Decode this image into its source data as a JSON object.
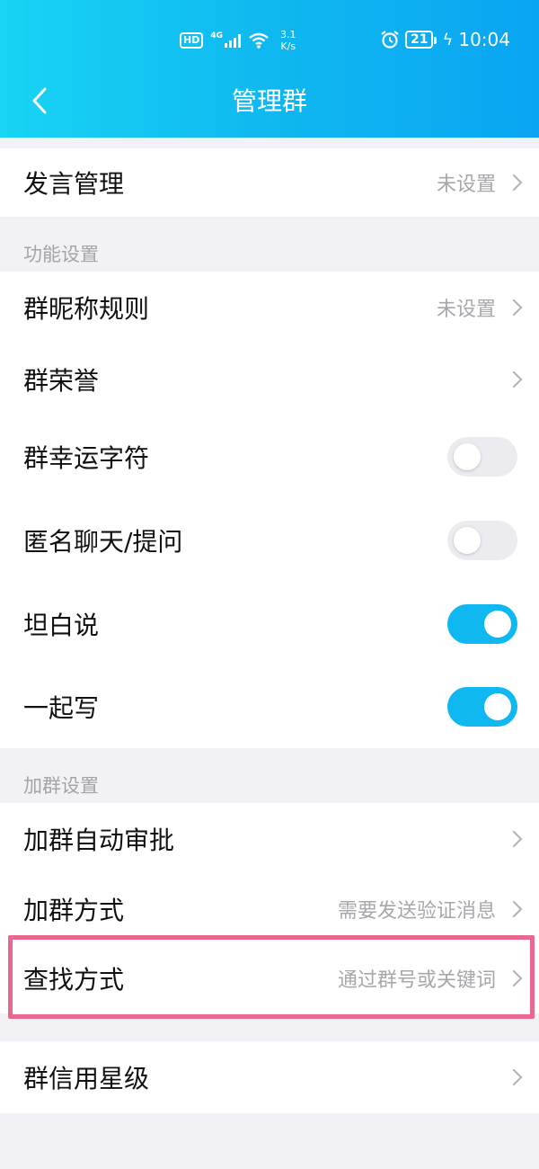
{
  "status_bar": {
    "hd": "HD",
    "network": "4G",
    "speed_value": "3.1",
    "speed_unit": "K/s",
    "battery": "21",
    "time": "10:04"
  },
  "header": {
    "title": "管理群"
  },
  "rows": {
    "speech_mgmt": {
      "label": "发言管理",
      "value": "未设置"
    },
    "nickname_rule": {
      "label": "群昵称规则",
      "value": "未设置"
    },
    "honor": {
      "label": "群荣誉"
    },
    "lucky_char": {
      "label": "群幸运字符",
      "toggle": false
    },
    "anonymous": {
      "label": "匿名聊天/提问",
      "toggle": false
    },
    "confession": {
      "label": "坦白说",
      "toggle": true
    },
    "write_together": {
      "label": "一起写",
      "toggle": true
    },
    "auto_approve": {
      "label": "加群自动审批"
    },
    "join_method": {
      "label": "加群方式",
      "value": "需要发送验证消息"
    },
    "search_method": {
      "label": "查找方式",
      "value": "通过群号或关键词"
    },
    "credit": {
      "label": "群信用星级"
    }
  },
  "sections": {
    "features": "功能设置",
    "join": "加群设置"
  },
  "colors": {
    "accent": "#0fb8f0",
    "highlight": "#e8688f",
    "value_text": "#a7a7ac"
  },
  "icons": {
    "back": "chevron-left-icon",
    "chevron": "chevron-right-icon",
    "alarm": "alarm-icon",
    "wifi": "wifi-icon"
  }
}
